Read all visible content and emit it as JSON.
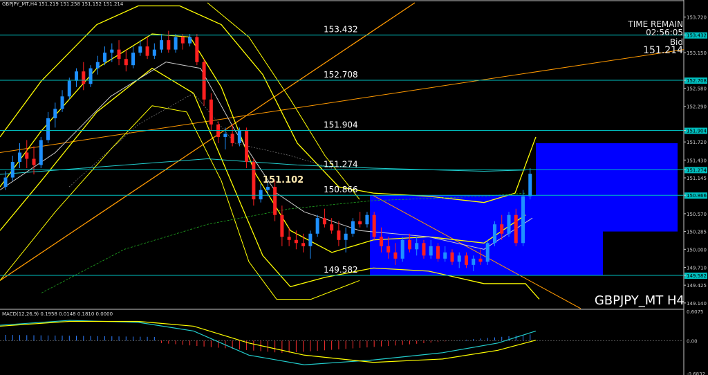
{
  "header": {
    "price_info": "GBPJPY_MT,H4  151.219 151.258 151.152 151.214",
    "macd_info": "MACD(12,26,9) 0.1958 0.0148 0.1810 0.0000"
  },
  "timer": {
    "label": "TIME REMAIN",
    "time": "02:56:05",
    "bid_label": "Bid",
    "bid": "151.214"
  },
  "symbol_label": "GBPJPY_MT H4",
  "chart_data": {
    "type": "candlestick",
    "title": "GBPJPY_MT H4",
    "price_axis": {
      "ylim": [
        149.05,
        153.95
      ],
      "ticks": [
        "153.720",
        "153.432",
        "153.150",
        "152.708",
        "152.580",
        "152.290",
        "151.904",
        "151.720",
        "151.430",
        "151.274",
        "151.145",
        "150.866",
        "150.570",
        "150.285",
        "150.000",
        "149.710",
        "149.582",
        "149.425",
        "149.140"
      ],
      "highlighted": [
        "153.432",
        "152.708",
        "151.904",
        "151.274",
        "150.866",
        "149.582"
      ]
    },
    "horizontal_levels": [
      {
        "value": 153.432,
        "label": "153.432"
      },
      {
        "value": 152.708,
        "label": "152.708"
      },
      {
        "value": 151.904,
        "label": "151.904"
      },
      {
        "value": 151.274,
        "label": "151.274"
      },
      {
        "value": 150.866,
        "label": "150.866"
      },
      {
        "value": 149.582,
        "label": "149.582"
      }
    ],
    "callout": {
      "value": 151.102,
      "label": "151.102"
    },
    "candles": [
      [
        151.0,
        151.25,
        150.95,
        151.15
      ],
      [
        151.15,
        151.5,
        151.1,
        151.4
      ],
      [
        151.4,
        151.7,
        151.3,
        151.55
      ],
      [
        151.55,
        151.75,
        151.3,
        151.45
      ],
      [
        151.45,
        151.65,
        151.2,
        151.35
      ],
      [
        151.35,
        151.8,
        151.3,
        151.75
      ],
      [
        151.75,
        152.2,
        151.7,
        152.1
      ],
      [
        152.1,
        152.35,
        151.95,
        152.25
      ],
      [
        152.25,
        152.55,
        152.2,
        152.45
      ],
      [
        152.45,
        152.75,
        152.4,
        152.7
      ],
      [
        152.7,
        152.9,
        152.6,
        152.85
      ],
      [
        152.85,
        153.0,
        152.55,
        152.65
      ],
      [
        152.65,
        152.95,
        152.6,
        152.9
      ],
      [
        152.9,
        153.1,
        152.8,
        153.0
      ],
      [
        153.0,
        153.25,
        152.95,
        153.15
      ],
      [
        153.15,
        153.3,
        153.0,
        153.2
      ],
      [
        153.2,
        153.35,
        152.95,
        153.05
      ],
      [
        153.05,
        153.2,
        152.85,
        152.95
      ],
      [
        152.95,
        153.25,
        152.9,
        153.15
      ],
      [
        153.15,
        153.35,
        153.1,
        153.25
      ],
      [
        153.25,
        153.4,
        153.05,
        153.1
      ],
      [
        153.1,
        153.3,
        153.05,
        153.2
      ],
      [
        153.2,
        153.45,
        153.15,
        153.35
      ],
      [
        153.35,
        153.5,
        153.15,
        153.2
      ],
      [
        153.2,
        153.45,
        153.15,
        153.4
      ],
      [
        153.4,
        153.45,
        153.2,
        153.3
      ],
      [
        153.3,
        153.45,
        153.25,
        153.4
      ],
      [
        153.4,
        153.45,
        152.95,
        153.0
      ],
      [
        153.0,
        153.05,
        152.3,
        152.4
      ],
      [
        152.4,
        152.5,
        151.9,
        152.0
      ],
      [
        152.0,
        152.05,
        151.7,
        151.8
      ],
      [
        151.8,
        151.95,
        151.6,
        151.85
      ],
      [
        151.85,
        152.0,
        151.65,
        151.7
      ],
      [
        151.7,
        151.95,
        151.65,
        151.9
      ],
      [
        151.9,
        151.95,
        151.3,
        151.4
      ],
      [
        151.4,
        151.45,
        150.7,
        150.8
      ],
      [
        150.8,
        151.05,
        150.75,
        150.95
      ],
      [
        150.95,
        151.1,
        150.85,
        151.0
      ],
      [
        151.0,
        151.1,
        150.45,
        150.55
      ],
      [
        150.55,
        150.7,
        150.05,
        150.2
      ],
      [
        150.2,
        150.35,
        150.05,
        150.15
      ],
      [
        150.15,
        150.3,
        150.0,
        150.1
      ],
      [
        150.1,
        150.25,
        149.95,
        150.05
      ],
      [
        150.05,
        150.3,
        149.85,
        150.25
      ],
      [
        150.25,
        150.55,
        150.2,
        150.5
      ],
      [
        150.5,
        150.65,
        150.35,
        150.4
      ],
      [
        150.4,
        150.5,
        150.25,
        150.3
      ],
      [
        150.3,
        150.45,
        150.05,
        150.15
      ],
      [
        150.15,
        150.35,
        149.95,
        150.25
      ],
      [
        150.25,
        150.5,
        150.2,
        150.45
      ],
      [
        150.45,
        150.6,
        150.35,
        150.4
      ],
      [
        150.4,
        150.6,
        150.35,
        150.55
      ],
      [
        150.55,
        150.6,
        150.15,
        150.2
      ],
      [
        150.2,
        150.35,
        149.95,
        150.05
      ],
      [
        150.05,
        150.2,
        149.85,
        149.95
      ],
      [
        149.95,
        150.1,
        149.75,
        149.85
      ],
      [
        149.85,
        150.2,
        149.8,
        150.15
      ],
      [
        150.15,
        150.25,
        149.95,
        150.0
      ],
      [
        150.0,
        150.2,
        149.9,
        150.1
      ],
      [
        150.1,
        150.15,
        149.85,
        149.9
      ],
      [
        149.9,
        150.15,
        149.85,
        150.05
      ],
      [
        150.05,
        150.1,
        149.8,
        149.85
      ],
      [
        149.85,
        150.05,
        149.8,
        149.95
      ],
      [
        149.95,
        150.0,
        149.75,
        149.8
      ],
      [
        149.8,
        149.95,
        149.7,
        149.9
      ],
      [
        149.9,
        149.95,
        149.7,
        149.75
      ],
      [
        149.75,
        149.9,
        149.65,
        149.85
      ],
      [
        149.85,
        150.0,
        149.75,
        149.8
      ],
      [
        149.8,
        150.15,
        149.75,
        150.1
      ],
      [
        150.1,
        150.45,
        150.05,
        150.4
      ],
      [
        150.4,
        150.55,
        150.15,
        150.25
      ],
      [
        150.25,
        150.6,
        150.2,
        150.55
      ],
      [
        150.55,
        150.65,
        150.05,
        150.1
      ],
      [
        150.1,
        150.95,
        150.05,
        150.85
      ],
      [
        150.85,
        151.3,
        150.8,
        151.21
      ]
    ],
    "macd": {
      "label": "MACD(12,26,9)",
      "values": {
        "macd": 0.1958,
        "signal": 0.0148,
        "histogram": 0.181
      },
      "axis_ticks": [
        "0.6075",
        "0.00",
        "-0.6832"
      ],
      "ylim": [
        -0.6832,
        0.6075
      ]
    }
  }
}
